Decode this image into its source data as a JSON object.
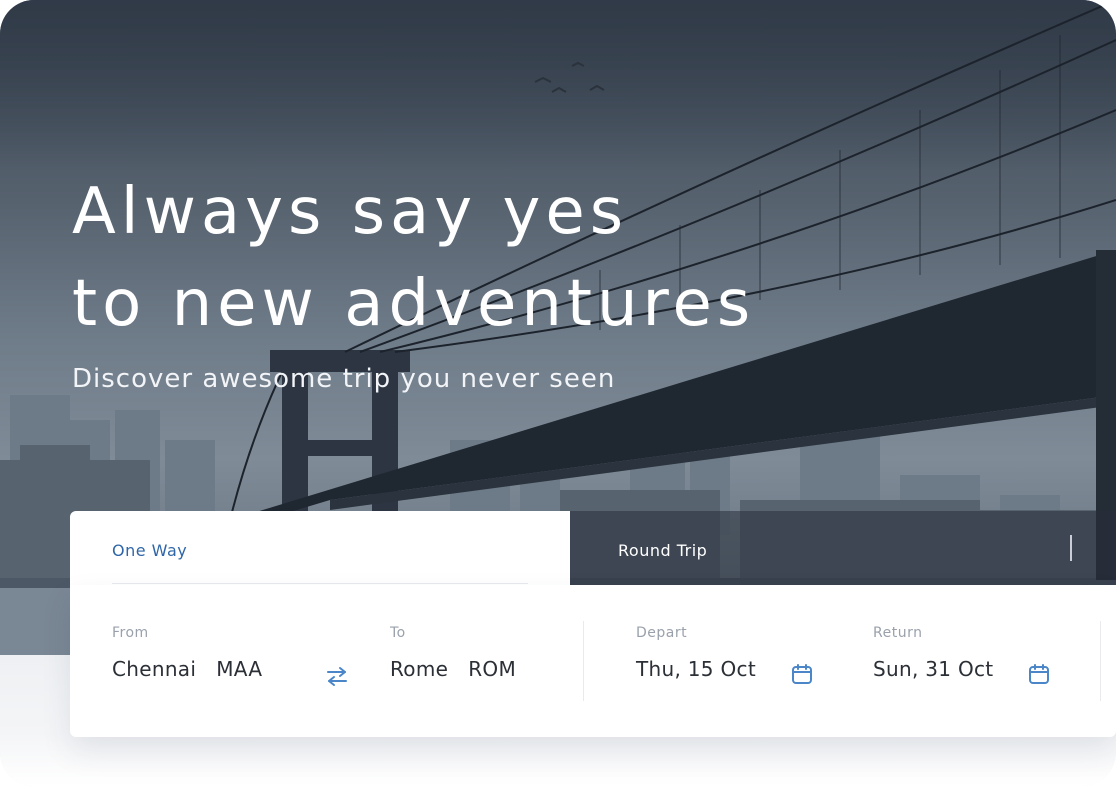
{
  "hero": {
    "headline_line1": "Always say yes",
    "headline_line2": "to new adventures",
    "subheadline": "Discover awesome trip you never seen"
  },
  "tabs": [
    {
      "label": "One Way",
      "active": true
    },
    {
      "label": "Round Trip",
      "active": false
    }
  ],
  "search": {
    "from": {
      "caption": "From",
      "city": "Chennai",
      "code": "MAA"
    },
    "to": {
      "caption": "To",
      "city": "Rome",
      "code": "ROM"
    },
    "depart": {
      "caption": "Depart",
      "date": "Thu, 15 Oct"
    },
    "return": {
      "caption": "Return",
      "date": "Sun, 31 Oct"
    },
    "swap_icon": "swap-arrows-icon",
    "calendar_icon": "calendar-icon"
  },
  "colors": {
    "accent": "#2f66a8",
    "icon": "#4a86c8",
    "text": "#2b2f36",
    "caption": "#9aa1ab"
  }
}
